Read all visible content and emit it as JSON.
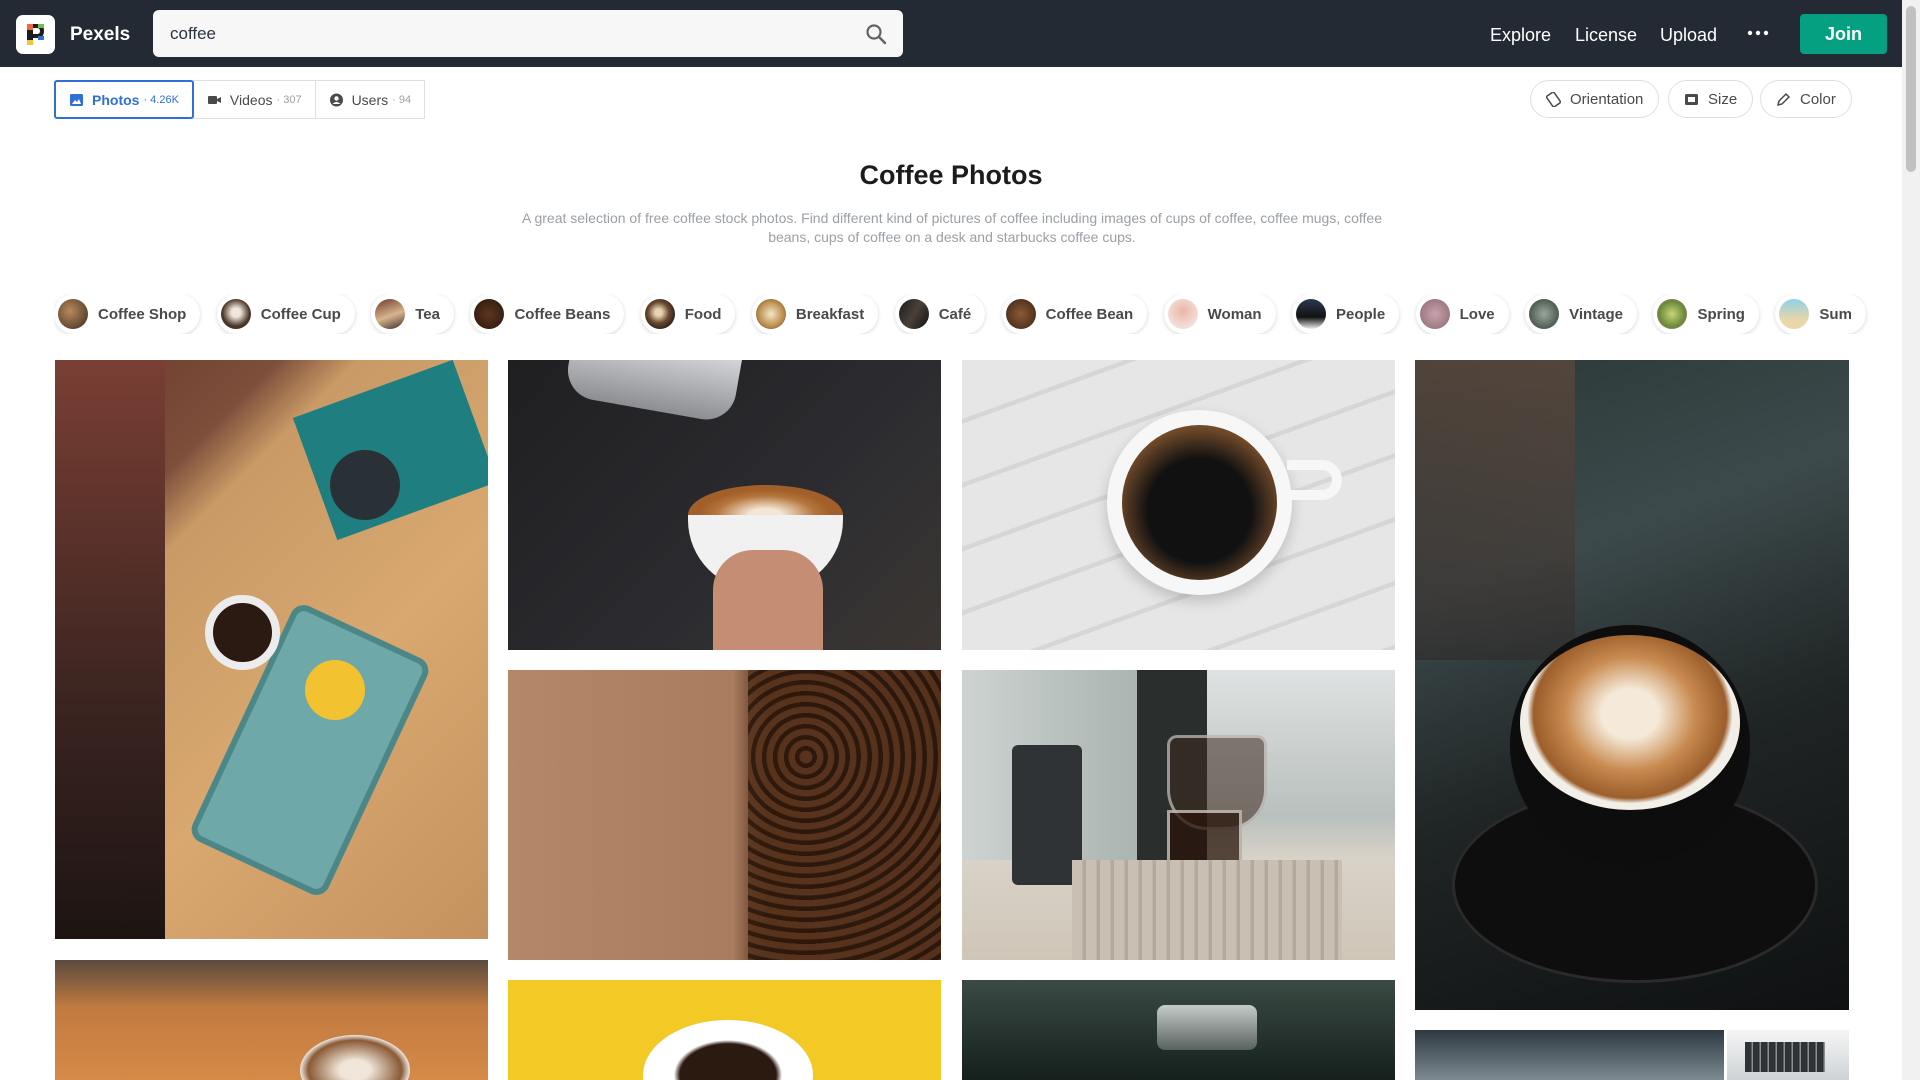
{
  "header": {
    "brand": "Pexels",
    "search_value": "coffee",
    "nav": [
      "Explore",
      "License",
      "Upload"
    ],
    "join_label": "Join"
  },
  "tabs": [
    {
      "label": "Photos",
      "count": "· 4.26K",
      "icon": "image-icon",
      "active": true
    },
    {
      "label": "Videos",
      "count": "· 307",
      "icon": "video-icon",
      "active": false
    },
    {
      "label": "Users",
      "count": "· 94",
      "icon": "user-icon",
      "active": false
    }
  ],
  "filters": [
    {
      "label": "Orientation",
      "icon": "orientation-icon"
    },
    {
      "label": "Size",
      "icon": "size-icon"
    },
    {
      "label": "Color",
      "icon": "pencil-icon"
    }
  ],
  "heading": {
    "title": "Coffee Photos",
    "description": "A great selection of free coffee stock photos. Find different kind of pictures of coffee including images of cups of coffee, coffee mugs, coffee beans, cups of coffee on a desk and starbucks coffee cups."
  },
  "chips": [
    "Coffee Shop",
    "Coffee Cup",
    "Tea",
    "Coffee Beans",
    "Food",
    "Breakfast",
    "Café",
    "Coffee Bean",
    "Woman",
    "People",
    "Love",
    "Vintage",
    "Spring",
    "Sum"
  ],
  "colors": {
    "header_bg": "#232a34",
    "accent_green": "#05a081",
    "accent_blue": "#2f6fd6"
  }
}
